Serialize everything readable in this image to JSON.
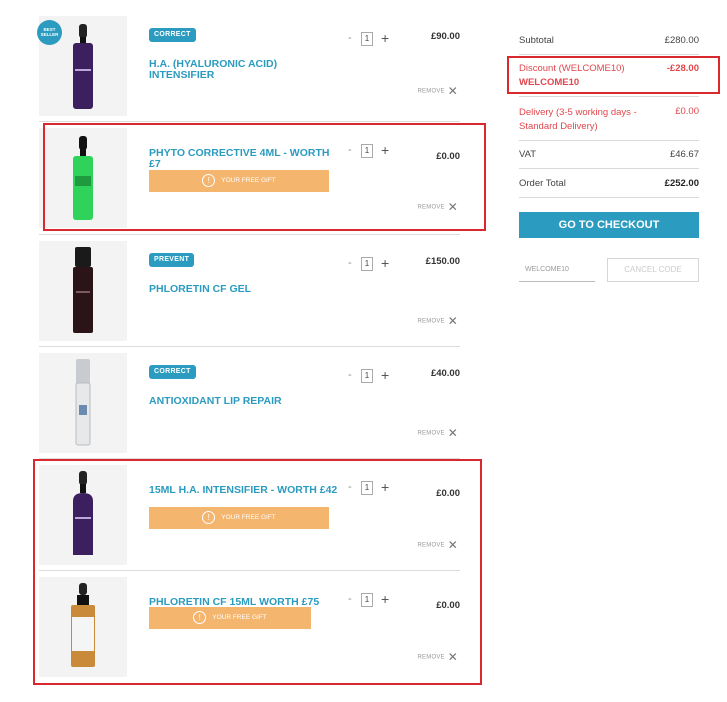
{
  "items": [
    {
      "badge": "CORRECT",
      "name": "H.A. (HYALURONIC ACID) INTENSIFIER",
      "qty": "1",
      "price": "£90.00",
      "remove": "REMOVE",
      "gift": "",
      "bestseller": "BEST SELLER",
      "bottle": "purple-dropper"
    },
    {
      "badge": "",
      "name": "PHYTO CORRECTIVE 4ML - WORTH £7",
      "qty": "1",
      "price": "£0.00",
      "remove": "REMOVE",
      "gift": "YOUR FREE GIFT",
      "bottle": "green-dropper"
    },
    {
      "badge": "PREVENT",
      "name": "PHLORETIN CF GEL",
      "qty": "1",
      "price": "£150.00",
      "remove": "REMOVE",
      "gift": "",
      "bottle": "dark-pump"
    },
    {
      "badge": "CORRECT",
      "name": "ANTIOXIDANT LIP REPAIR",
      "qty": "1",
      "price": "£40.00",
      "remove": "REMOVE",
      "gift": "",
      "bottle": "silver-tube"
    },
    {
      "badge": "",
      "name": "15ML H.A. INTENSIFIER - WORTH £42",
      "qty": "1",
      "price": "£0.00",
      "remove": "REMOVE",
      "gift": "YOUR FREE GIFT",
      "bottle": "purple-dropper"
    },
    {
      "badge": "",
      "name": "PHLORETIN CF 15ML WORTH £75",
      "qty": "1",
      "price": "£0.00",
      "remove": "REMOVE",
      "gift": "YOUR FREE GIFT",
      "bottle": "amber-dropper"
    }
  ],
  "summary": {
    "subtotal_label": "Subtotal",
    "subtotal_value": "£280.00",
    "discount_label": "Discount (WELCOME10)",
    "discount_value": "-£28.00",
    "discount_code": "WELCOME10",
    "delivery_label": "Delivery (3-5 working days - Standard Delivery)",
    "delivery_value": "£0.00",
    "vat_label": "VAT",
    "vat_value": "£46.67",
    "total_label": "Order Total",
    "total_value": "£252.00",
    "checkout_label": "GO TO CHECKOUT",
    "promo_value": "WELCOME10",
    "cancel_label": "CANCEL CODE"
  },
  "qty_minus": "-",
  "qty_plus": "+",
  "remove_icon": "close-icon",
  "gift_icon": "alert-circle-icon",
  "colors": {
    "accent": "#2b9bbf",
    "gift": "#f4b56f",
    "highlight": "#d9282e",
    "discount": "#e0474c"
  }
}
